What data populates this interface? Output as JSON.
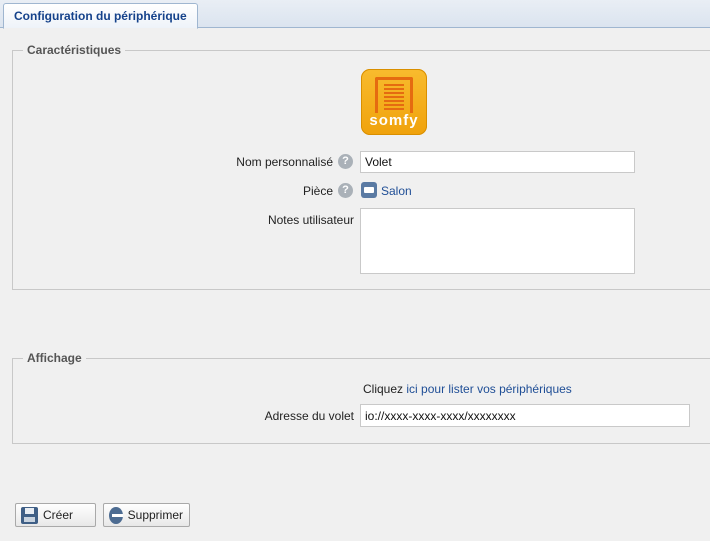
{
  "tab": {
    "label": "Configuration du périphérique"
  },
  "caracteristiques": {
    "legend": "Caractéristiques",
    "logo_text": "somfy",
    "nom_label": "Nom personnalisé",
    "nom_value": "Volet",
    "piece_label": "Pièce",
    "piece_value": "Salon",
    "notes_label": "Notes utilisateur",
    "notes_value": ""
  },
  "affichage": {
    "legend": "Affichage",
    "cliquez": "Cliquez",
    "ici_link": "ici pour lister vos périphériques",
    "adresse_label": "Adresse du volet",
    "adresse_value": "io://xxxx-xxxx-xxxx/xxxxxxxx"
  },
  "buttons": {
    "creer": "Créer",
    "supprimer": "Supprimer"
  },
  "icons": {
    "help": "help-icon",
    "room": "room-icon",
    "save": "save-icon",
    "delete": "delete-icon"
  }
}
